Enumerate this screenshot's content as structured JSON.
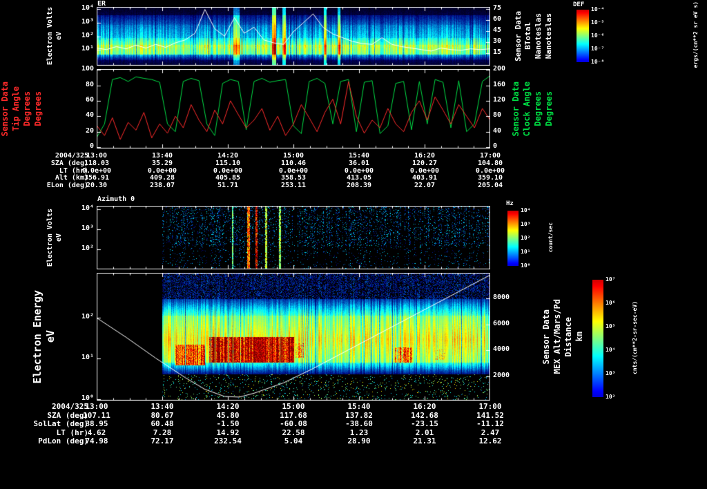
{
  "panels": {
    "er": {
      "title": "ER",
      "ylabel_lines": [
        "Electron Volts",
        "eV"
      ],
      "y_ticks": [
        "10⁴",
        "10³",
        "10²",
        "10¹"
      ],
      "right_axis_ticks": [
        "75",
        "60",
        "45",
        "30",
        "15"
      ],
      "right_label_lines": [
        "Sensor Data",
        "BTotal",
        "Nanoteslas",
        "Nanoteslas"
      ],
      "colorbar": {
        "title": "DEF",
        "ticks": [
          "10⁻⁴",
          "10⁻⁵",
          "10⁻⁶",
          "10⁻⁷",
          "10⁻⁸"
        ],
        "units": "ergs/(cm**2 sr eV s)"
      }
    },
    "angles": {
      "left_ticks": [
        "100",
        "80",
        "60",
        "40",
        "20",
        "0"
      ],
      "left_label_lines": [
        "Sensor Data",
        "Tip Angle",
        "Degrees",
        "Degrees"
      ],
      "right_ticks": [
        "200",
        "160",
        "120",
        "80",
        "40",
        "0"
      ],
      "right_label_lines": [
        "Sensor Data",
        "Clock Angle",
        "Degrees",
        "Degrees"
      ]
    },
    "azimuth": {
      "title": "Azimuth 0",
      "ylabel_lines": [
        "Electron Volts",
        "eV"
      ],
      "y_ticks": [
        "10⁴",
        "10³",
        "10²"
      ],
      "colorbar": {
        "title": "Hz",
        "ticks": [
          "10⁴",
          "10³",
          "10²",
          "10¹",
          "10⁰"
        ],
        "units": "count/sec"
      }
    },
    "main": {
      "ylabel_lines": [
        "Electron Energy",
        "eV"
      ],
      "y_ticks": [
        "10²",
        "10¹",
        "10⁰"
      ],
      "right_axis_ticks": [
        "8000",
        "6000",
        "4000",
        "2000"
      ],
      "right_label_lines": [
        "Sensor Data",
        "MEX Alt/Mars/Pd",
        "Distance",
        "km"
      ],
      "colorbar": {
        "ticks": [
          "10⁷",
          "10⁶",
          "10⁵",
          "10⁴",
          "10³",
          "10²"
        ],
        "units": "cnts/(cm**2-sr-sec-eV)"
      }
    }
  },
  "ephemeris_top": {
    "date_label": "2004/325",
    "time_ticks": [
      "13:00",
      "13:40",
      "14:20",
      "15:00",
      "15:40",
      "16:20",
      "17:00"
    ],
    "rows": [
      {
        "label": "SZA (deg)",
        "values": [
          "118.03",
          "35.29",
          "115.10",
          "110.46",
          "36.01",
          "120.27",
          "104.80"
        ]
      },
      {
        "label": "LT (hr)",
        "values": [
          "0.0e+00",
          "0.0e+00",
          "0.0e+00",
          "0.0e+00",
          "0.0e+00",
          "0.0e+00",
          "0.0e+00"
        ]
      },
      {
        "label": "Alt (km)",
        "values": [
          "356.91",
          "409.28",
          "405.85",
          "358.53",
          "413.05",
          "403.91",
          "359.10"
        ]
      },
      {
        "label": "ELon (deg)",
        "values": [
          "20.30",
          "238.07",
          "51.71",
          "253.11",
          "208.39",
          "22.07",
          "205.04"
        ]
      }
    ]
  },
  "ephemeris_bottom": {
    "date_label": "2004/325",
    "time_ticks": [
      "13:00",
      "13:40",
      "14:20",
      "15:00",
      "15:40",
      "16:20",
      "17:00"
    ],
    "rows": [
      {
        "label": "SZA (deg)",
        "values": [
          "107.11",
          "80.67",
          "45.80",
          "117.68",
          "137.82",
          "142.68",
          "141.52"
        ]
      },
      {
        "label": "SolLat (deg)",
        "values": [
          "38.95",
          "60.48",
          "-1.50",
          "-60.08",
          "-38.60",
          "-23.15",
          "-11.12"
        ]
      },
      {
        "label": "LT (hr)",
        "values": [
          "4.62",
          "7.28",
          "14.92",
          "22.58",
          "1.23",
          "2.01",
          "2.47"
        ]
      },
      {
        "label": "PdLon (deg)",
        "values": [
          "74.98",
          "72.17",
          "232.54",
          "5.04",
          "28.90",
          "21.31",
          "12.62"
        ]
      }
    ]
  },
  "colors": {
    "foreground": "#ffffff",
    "tip_angle": "#ff2a2a",
    "clock_angle": "#00dd44",
    "overlay_line": "#ffffff"
  },
  "chart_data": [
    {
      "id": "er",
      "type": "heatmap",
      "title": "ER",
      "x_ticks": [
        "13:00",
        "13:40",
        "14:20",
        "15:00",
        "15:40",
        "16:20",
        "17:00"
      ],
      "y_scale": "log",
      "y_ticks": [
        "10⁴",
        "10³",
        "10²",
        "10¹"
      ],
      "ylabel": "Electron Volts eV",
      "value_label": "DEF",
      "value_units": "ergs/(cm**2 sr eV s)",
      "value_ticks": [
        "10⁻⁴",
        "10⁻⁵",
        "10⁻⁶",
        "10⁻⁷",
        "10⁻⁸"
      ],
      "seed": 42,
      "bands": [
        {
          "f0": 0.0,
          "f1": 0.14,
          "v0": 0.03,
          "v1": 0.07
        },
        {
          "f0": 0.14,
          "f1": 0.3,
          "v0": 0.15,
          "v1": 0.24
        },
        {
          "f0": 0.3,
          "f1": 0.52,
          "v0": 0.26,
          "v1": 0.33
        },
        {
          "f0": 0.52,
          "f1": 0.64,
          "v0": 0.37,
          "v1": 0.48
        },
        {
          "f0": 0.64,
          "f1": 0.8,
          "v0": 0.55,
          "v1": 0.48
        },
        {
          "f0": 0.8,
          "f1": 0.9,
          "v0": 0.32,
          "v1": 0.14
        },
        {
          "f0": 0.9,
          "f1": 1.0,
          "v0": 0.1,
          "v1": 0.04
        }
      ],
      "streaks": [
        {
          "x": 0.355,
          "w": 0.008,
          "boost": 0.22
        },
        {
          "x": 0.45,
          "w": 0.005,
          "boost": 0.4
        },
        {
          "x": 0.475,
          "w": 0.004,
          "boost": 0.3
        },
        {
          "x": 0.58,
          "w": 0.004,
          "boost": 0.33
        },
        {
          "x": 0.615,
          "w": 0.003,
          "boost": 0.28
        }
      ]
    },
    {
      "id": "btotal",
      "type": "line",
      "name": "BTotal (Nanoteslas)",
      "axis_ticks": [
        75,
        60,
        45,
        30,
        15
      ],
      "t0": 13.0,
      "dt": 0.1,
      "values": [
        22,
        20,
        24,
        21,
        26,
        22,
        27,
        23,
        29,
        33,
        42,
        74,
        48,
        38,
        63,
        42,
        50,
        33,
        29,
        27,
        44,
        56,
        68,
        50,
        41,
        36,
        31,
        28,
        27,
        36,
        27,
        24,
        22,
        20,
        18,
        22,
        20,
        19,
        21,
        20,
        21
      ]
    },
    {
      "id": "tip_angle",
      "type": "line",
      "name": "Tip Angle (Degrees)",
      "color": "#ff2a2a",
      "range": [
        0,
        100
      ],
      "t0": 13.0,
      "dt": 0.08,
      "values": [
        28,
        15,
        38,
        10,
        32,
        22,
        45,
        12,
        30,
        18,
        40,
        25,
        55,
        35,
        20,
        48,
        30,
        60,
        42,
        25,
        35,
        50,
        22,
        40,
        15,
        30,
        55,
        38,
        20,
        45,
        62,
        30,
        85,
        40,
        18,
        35,
        25,
        50,
        30,
        20,
        45,
        60,
        35,
        65,
        48,
        30,
        55,
        40,
        25,
        50,
        35
      ]
    },
    {
      "id": "clock_angle",
      "type": "line",
      "name": "Clock Angle (Degrees)",
      "color": "#00dd44",
      "range": [
        0,
        200
      ],
      "t0": 13.0,
      "dt": 0.08,
      "values": [
        25,
        60,
        175,
        180,
        170,
        182,
        178,
        175,
        168,
        60,
        40,
        170,
        178,
        172,
        60,
        30,
        165,
        175,
        170,
        45,
        170,
        178,
        168,
        172,
        175,
        55,
        35,
        170,
        178,
        165,
        60,
        170,
        175,
        40,
        168,
        172,
        35,
        55,
        165,
        170,
        45,
        170,
        60,
        175,
        168,
        50,
        172,
        40,
        60,
        170,
        185
      ]
    },
    {
      "id": "az",
      "type": "heatmap",
      "title": "Azimuth 0",
      "y_ticks": [
        "10⁴",
        "10³",
        "10²"
      ],
      "ylabel": "Electron Volts eV",
      "value_label": "Hz",
      "value_units": "count/sec",
      "value_ticks": [
        "10⁴",
        "10³",
        "10²",
        "10¹",
        "10⁰"
      ],
      "seed": 7,
      "data_start": 0.165,
      "column_active_p": 0.82,
      "dot_density": 0.16,
      "bright_streaks": [
        {
          "x": 0.345,
          "w": 0.002,
          "v": 0.5
        },
        {
          "x": 0.385,
          "w": 0.004,
          "v": 0.8
        },
        {
          "x": 0.405,
          "w": 0.003,
          "v": 0.95
        },
        {
          "x": 0.43,
          "w": 0.003,
          "v": 0.6
        },
        {
          "x": 0.465,
          "w": 0.002,
          "v": 0.55
        }
      ]
    },
    {
      "id": "main",
      "type": "heatmap",
      "ylabel": "Electron Energy eV",
      "y_scale": "log",
      "y_ticks": [
        "10²",
        "10¹",
        "10⁰"
      ],
      "value_units": "cnts/(cm**2-sr-sec-eV)",
      "value_ticks": [
        "10⁷",
        "10⁶",
        "10⁵",
        "10⁴",
        "10³",
        "10²"
      ],
      "seed": 1234,
      "data_start": 0.165,
      "bands": [
        {
          "f0": 0.0,
          "f1": 0.2,
          "speck": 0.5,
          "speckv": 0.17,
          "v0": 0,
          "v1": 0
        },
        {
          "f0": 0.2,
          "f1": 0.33,
          "v0": 0.2,
          "v1": 0.42
        },
        {
          "f0": 0.33,
          "f1": 0.52,
          "v0": 0.48,
          "v1": 0.6
        },
        {
          "f0": 0.52,
          "f1": 0.7,
          "v0": 0.6,
          "v1": 0.5
        },
        {
          "f0": 0.7,
          "f1": 0.79,
          "v0": 0.4,
          "v1": 0.15
        },
        {
          "f0": 0.79,
          "f1": 1.0,
          "speck": 0.05,
          "speckv": 0.45,
          "v0": 0,
          "v1": 0
        }
      ],
      "hotspots": [
        {
          "x0": 0.2,
          "x1": 0.275,
          "f0": 0.56,
          "f1": 0.72,
          "v": 0.8
        },
        {
          "x0": 0.285,
          "x1": 0.5,
          "f0": 0.5,
          "f1": 0.7,
          "v": 0.97
        },
        {
          "x0": 0.505,
          "x1": 0.525,
          "f0": 0.55,
          "f1": 0.66,
          "v": 0.68
        },
        {
          "x0": 0.755,
          "x1": 0.8,
          "f0": 0.58,
          "f1": 0.7,
          "v": 0.75
        },
        {
          "x0": 0.86,
          "x1": 0.885,
          "f0": 0.6,
          "f1": 0.68,
          "v": 0.6
        }
      ]
    },
    {
      "id": "altitude",
      "type": "line",
      "name": "MEX Alt/Mars/Pd Distance (km)",
      "axis_ticks": [
        8000,
        6000,
        4000,
        2000
      ],
      "points": [
        [
          13.0,
          6500
        ],
        [
          13.3,
          5000
        ],
        [
          13.6,
          3400
        ],
        [
          13.9,
          1900
        ],
        [
          14.1,
          1000
        ],
        [
          14.3,
          450
        ],
        [
          14.45,
          400
        ],
        [
          14.6,
          700
        ],
        [
          14.9,
          1500
        ],
        [
          15.2,
          2600
        ],
        [
          15.5,
          3800
        ],
        [
          15.8,
          5000
        ],
        [
          16.1,
          6200
        ],
        [
          16.4,
          7400
        ],
        [
          16.7,
          8600
        ],
        [
          17.0,
          9800
        ]
      ]
    }
  ]
}
